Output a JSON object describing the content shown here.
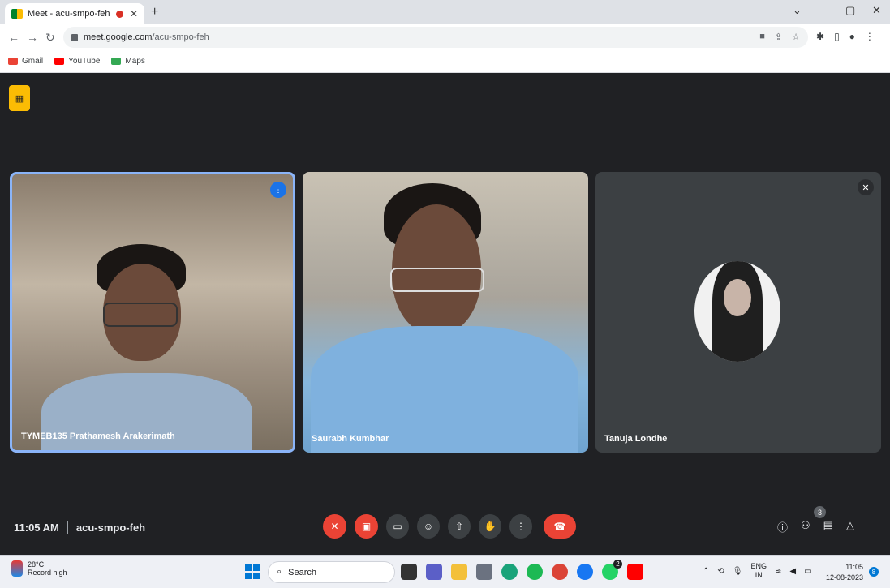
{
  "browser": {
    "tab_title": "Meet - acu-smpo-feh",
    "url_domain": "meet.google.com",
    "url_path": "/acu-smpo-feh",
    "bookmarks": [
      {
        "label": "Gmail",
        "color": "#ea4335"
      },
      {
        "label": "YouTube",
        "color": "#ff0000"
      },
      {
        "label": "Maps",
        "color": "#34a853"
      }
    ]
  },
  "meet": {
    "participants": [
      {
        "name": "TYMEB135 Prathamesh Arakerimath",
        "speaking": true
      },
      {
        "name": "Saurabh Kumbhar",
        "speaking": false
      },
      {
        "name": "Tanuja Londhe",
        "muted": true
      }
    ],
    "time": "11:05 AM",
    "meeting_code": "acu-smpo-feh",
    "people_count": "3"
  },
  "taskbar": {
    "temperature": "28°C",
    "weather_note": "Record high",
    "search_placeholder": "Search",
    "whatsapp_badge": "2",
    "language_line1": "ENG",
    "language_line2": "IN",
    "clock_time": "11:05",
    "clock_date": "12-08-2023",
    "notification_count": "8"
  },
  "colors": {
    "meet_bg": "#202124",
    "end_call": "#ea4335",
    "active_speaker_border": "#8ab4f8",
    "accent": "#1a73e8"
  }
}
